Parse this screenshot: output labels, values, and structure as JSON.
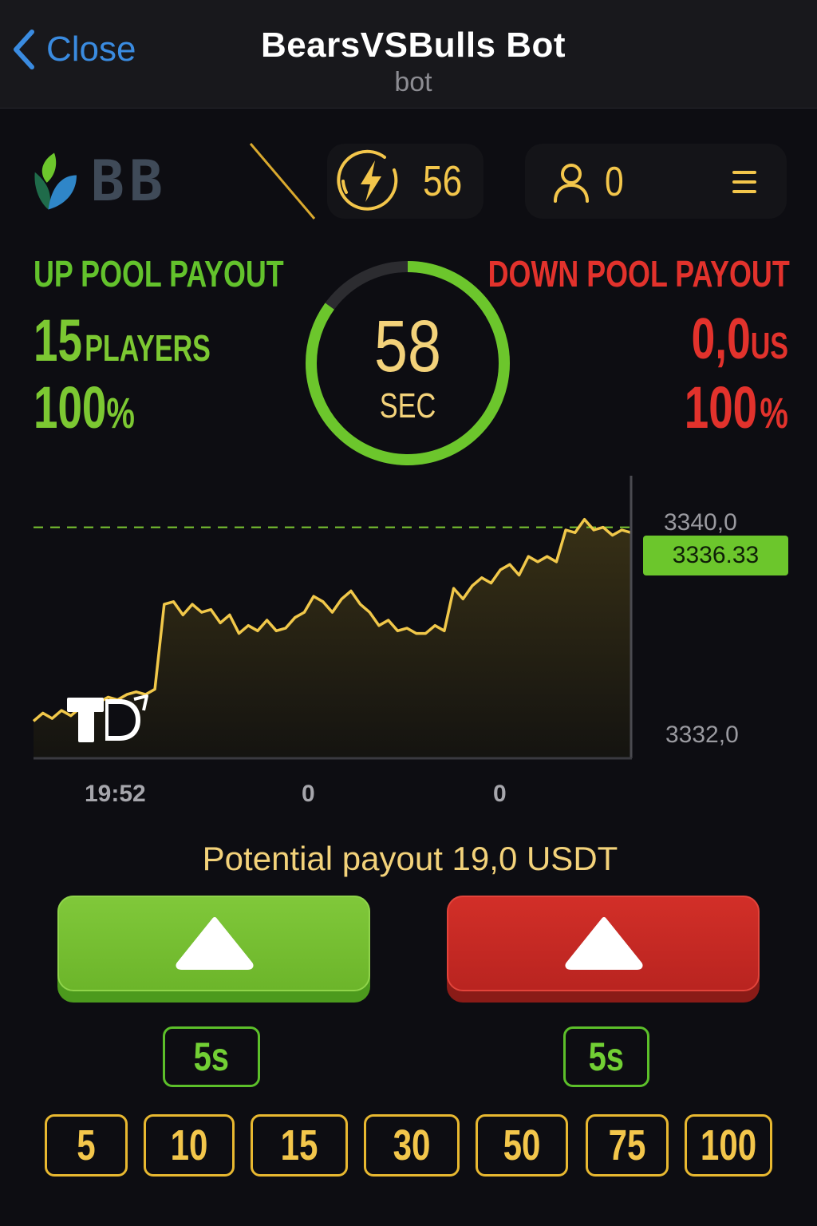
{
  "topbar": {
    "close_label": "Close",
    "title": "BearsVSBulls Bot",
    "subtitle": "bot"
  },
  "brand": {
    "logo_text": "BB"
  },
  "energy": {
    "value": "56",
    "icon": "lightning-icon"
  },
  "user": {
    "count": "0",
    "icon": "user-icon",
    "menu_icon": "hamburger-menu-icon"
  },
  "up_pool": {
    "title": "UP POOL PAYOUT",
    "players_num": "15",
    "players_label": "PLAYERS",
    "percent_num": "100",
    "percent_sign": "%"
  },
  "down_pool": {
    "title": "DOWN POOL PAYOUT",
    "amount_num": "0,0",
    "amount_unit": "US",
    "percent_num": "100",
    "percent_sign": "%"
  },
  "timer": {
    "value": "58",
    "unit": "SEC",
    "progress_fraction": 0.85
  },
  "chart_data": {
    "type": "area",
    "current_price_label": "3336.33",
    "y_tick_labels": [
      "3340,0",
      "3332,0"
    ],
    "ylim": [
      3332,
      3340
    ],
    "reference_line": 3339.8,
    "x_tick_labels": [
      "19:52",
      "0",
      "0"
    ],
    "values": [
      3332.5,
      3332.8,
      3332.6,
      3332.9,
      3332.7,
      3333.0,
      3332.8,
      3333.2,
      3333.4,
      3333.3,
      3333.5,
      3333.6,
      3333.5,
      3333.7,
      3336.9,
      3337.0,
      3336.5,
      3336.9,
      3336.6,
      3336.7,
      3336.2,
      3336.5,
      3335.8,
      3336.1,
      3335.9,
      3336.3,
      3335.9,
      3336.0,
      3336.4,
      3336.6,
      3337.2,
      3337.0,
      3336.6,
      3337.1,
      3337.4,
      3336.9,
      3336.6,
      3336.1,
      3336.3,
      3335.9,
      3336.0,
      3335.8,
      3335.8,
      3336.1,
      3335.9,
      3337.5,
      3337.1,
      3337.6,
      3337.9,
      3337.7,
      3338.2,
      3338.4,
      3338.0,
      3338.7,
      3338.5,
      3338.7,
      3338.5,
      3339.7,
      3339.6,
      3340.1,
      3339.7,
      3339.8,
      3339.5,
      3339.7,
      3339.6
    ],
    "colors": {
      "line": "#f1c84a",
      "fill_top": "#3a3216",
      "reference": "#7cc832",
      "price_tag": "#6cc62c"
    }
  },
  "payout": {
    "text": "Potential payout 19,0 USDT"
  },
  "buttons": {
    "up_icon": "triangle-up-icon",
    "down_icon": "triangle-up-icon"
  },
  "durations": {
    "left": "5s",
    "right": "5s"
  },
  "amounts": [
    "5",
    "10",
    "15",
    "30",
    "50",
    "75",
    "100"
  ],
  "colors": {
    "green": "#7cc832",
    "red": "#e2322c",
    "gold": "#f3c64b",
    "bg": "#0d0d12",
    "link": "#3a8be0"
  }
}
